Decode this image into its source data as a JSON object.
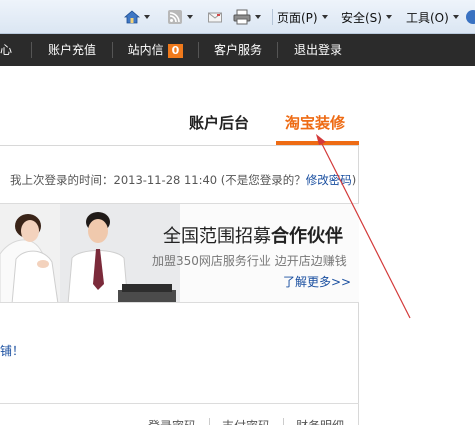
{
  "browser_toolbar": {
    "page_label": "页面(P)",
    "safety_label": "安全(S)",
    "tools_label": "工具(O)"
  },
  "site_nav": {
    "items": [
      {
        "label": "心"
      },
      {
        "label": "账户充值"
      },
      {
        "label": "站内信"
      },
      {
        "label": "客户服务"
      },
      {
        "label": "退出登录"
      }
    ],
    "message_count": "0"
  },
  "tabs": {
    "account": "账户后台",
    "decor": "淘宝装修"
  },
  "last_login": {
    "prefix": "我上次登录的时间：2013-11-28 11:40 (不是您登录的？",
    "link": "修改密码",
    "suffix": ")"
  },
  "banner": {
    "title_normal": "全国范围招募",
    "title_bold": "合作伙伴",
    "subtitle": "加盟350网店服务行业  边开店边赚钱",
    "more_link": "了解更多>>"
  },
  "side_text": "铺！",
  "bottom_links": [
    "登录密码",
    "支付密码",
    "财务明细"
  ],
  "colors": {
    "accent": "#ee6b14",
    "nav_bg": "#2b2b2b",
    "link": "#1a4fa0",
    "arrow": "#d33a3a"
  }
}
